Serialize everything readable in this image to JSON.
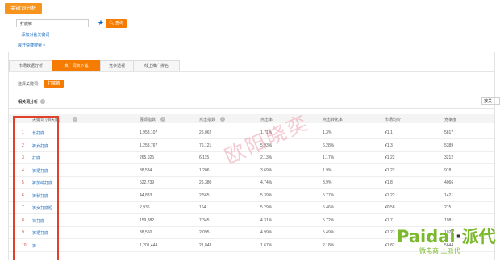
{
  "header": {
    "title": "关键词分析"
  },
  "search": {
    "keyword": "打底裤",
    "star_icon": "star-icon",
    "query_label": "查询",
    "add_compare": "添加对比关键词",
    "expand_search": "展开快捷搜索"
  },
  "tabs": [
    {
      "label": "市场数据分析",
      "active": false
    },
    {
      "label": "推广词表下载",
      "active": true
    },
    {
      "label": "竞争透视",
      "active": false
    },
    {
      "label": "线上推广排名",
      "active": false
    }
  ],
  "selected_keyword": {
    "label": "选择关键词:",
    "value": "打底裤"
  },
  "related": {
    "title": "相关词分析",
    "sort_value": "按关"
  },
  "table": {
    "headers": [
      "关键词 (相关度)",
      "展现指数",
      "点击指数",
      "点击率",
      "点击转化率",
      "市场均价",
      "竞争度"
    ],
    "rows": [
      {
        "rank": "1",
        "keyword": "长打底",
        "impressions": "1,953,107",
        "clicks": "26,062",
        "ctr": "1.71%",
        "cvr": "1.3%",
        "price": "¥1.1",
        "competition": "5817"
      },
      {
        "rank": "2",
        "keyword": "裤女打底",
        "impressions": "1,253,767",
        "clicks": "76,121",
        "ctr": "5.93%",
        "cvr": "6.28%",
        "price": "¥1.3",
        "competition": "5389"
      },
      {
        "rank": "3",
        "keyword": "打底",
        "impressions": "265,025",
        "clicks": "6,115",
        "ctr": "2.13%",
        "cvr": "1.17%",
        "price": "¥1.22",
        "competition": "3212"
      },
      {
        "rank": "4",
        "keyword": "裤裙打底",
        "impressions": "38,584",
        "clicks": "1,206",
        "ctr": "3.69%",
        "cvr": "1.9%",
        "price": "¥1.22",
        "competition": "918"
      },
      {
        "rank": "5",
        "keyword": "裤加绒打底",
        "impressions": "522,739",
        "clicks": "26,380",
        "ctr": "4.74%",
        "cvr": "3.9%",
        "price": "¥1.8",
        "competition": "4066"
      },
      {
        "rank": "6",
        "keyword": "裤秋打底",
        "impressions": "44,833",
        "clicks": "2,565",
        "ctr": "5.39%",
        "cvr": "5.77%",
        "price": "¥1.22",
        "competition": "1421"
      },
      {
        "rank": "7",
        "keyword": "裤女打底短",
        "impressions": "2,936",
        "clicks": "164",
        "ctr": "5.29%",
        "cvr": "5.46%",
        "price": "¥0.58",
        "competition": "215"
      },
      {
        "rank": "8",
        "keyword": "袜打底",
        "impressions": "159,882",
        "clicks": "7,345",
        "ctr": "4.31%",
        "cvr": "5.72%",
        "price": "¥1.7",
        "competition": "1981"
      },
      {
        "rank": "9",
        "keyword": "裤裙打底",
        "impressions": "38,560",
        "clicks": "2,095",
        "ctr": "4.99%",
        "cvr": "5.49%",
        "price": "¥1.22",
        "competition": "1024"
      },
      {
        "rank": "10",
        "keyword": "裤",
        "impressions": "1,201,444",
        "clicks": "21,843",
        "ctr": "1.67%",
        "cvr": "2.18%",
        "price": "¥1.82",
        "competition": "5644"
      }
    ]
  },
  "watermark": "欧阳晓奕",
  "logo": {
    "latin": "Paidai",
    "cn": "派代",
    "tagline": "微电商 上派代"
  },
  "colors": {
    "accent": "#f57c00",
    "link": "#1f6fbf",
    "highlight_box": "#e0412a",
    "logo": "#7ab82c"
  }
}
